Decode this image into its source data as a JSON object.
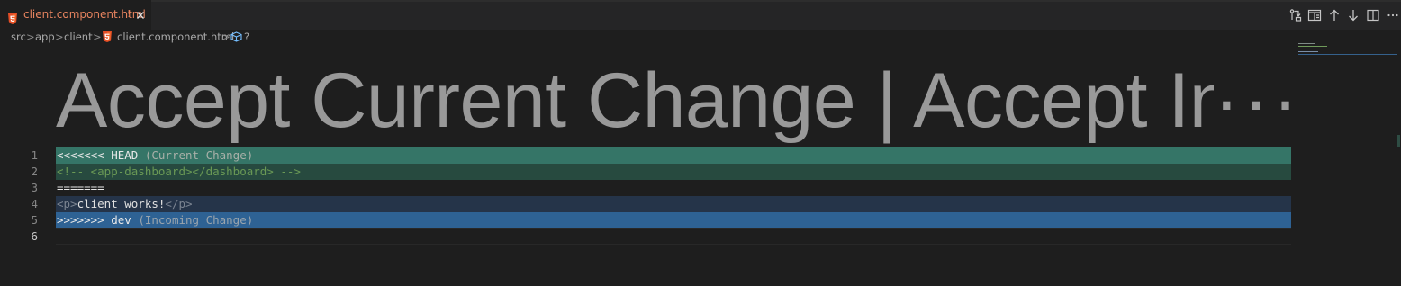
{
  "tab": {
    "filename": "client.component.html",
    "modified_marker": "!",
    "close_label": "×"
  },
  "editor_actions": [
    "open-changes-icon",
    "split-preview-icon",
    "arrow-up-icon",
    "arrow-down-icon",
    "split-editor-icon",
    "more-actions-icon"
  ],
  "breadcrumb": {
    "items": [
      "src",
      "app",
      "client",
      "client.component.html",
      "?"
    ],
    "separator": ">"
  },
  "codelens": {
    "text": "Accept Current Change | Accept In",
    "ellipsis": "···"
  },
  "code": {
    "lines": [
      {
        "number": "1",
        "marker": "<<<<<<<",
        "branch": " HEAD",
        "label": " (Current Change)"
      },
      {
        "number": "2",
        "text": "<!-- <app-dashboard></dashboard> -->"
      },
      {
        "number": "3",
        "text": "======="
      },
      {
        "number": "4",
        "open_tag": "<p>",
        "text": "client works!",
        "close_tag": "</p>"
      },
      {
        "number": "5",
        "marker": ">>>>>>>",
        "branch": " dev",
        "label": " (Incoming Change)"
      },
      {
        "number": "6",
        "text": ""
      }
    ]
  },
  "colors": {
    "current_header": "#357567",
    "current_body": "#274a3f",
    "incoming_body": "#253449",
    "incoming_header": "#2e6294",
    "tab_text": "#e8845f"
  }
}
